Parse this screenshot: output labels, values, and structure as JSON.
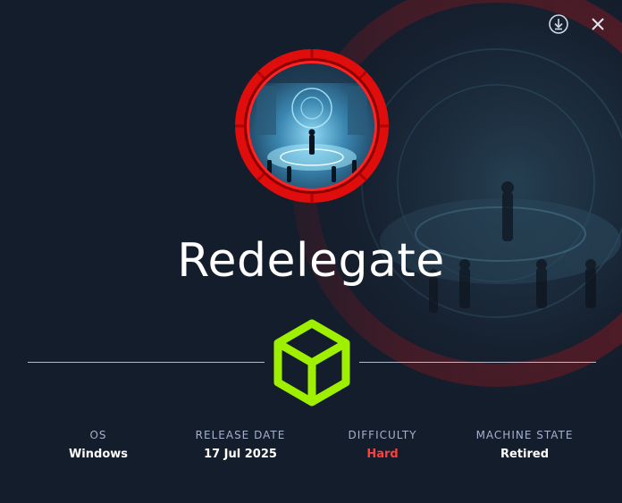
{
  "machine": {
    "name": "Redelegate"
  },
  "actions": {
    "download_icon": "download-icon",
    "close_icon": "close-icon"
  },
  "info": [
    {
      "label": "OS",
      "value": "Windows"
    },
    {
      "label": "RELEASE DATE",
      "value": "17 Jul 2025"
    },
    {
      "label": "DIFFICULTY",
      "value": "Hard"
    },
    {
      "label": "MACHINE STATE",
      "value": "Retired"
    }
  ],
  "colors": {
    "background": "#141d2b",
    "accent_green": "#9fef00",
    "ring_red": "#ff1a1a",
    "difficulty_hard": "#ff3e3e",
    "label_gray": "#a4b1cd"
  }
}
